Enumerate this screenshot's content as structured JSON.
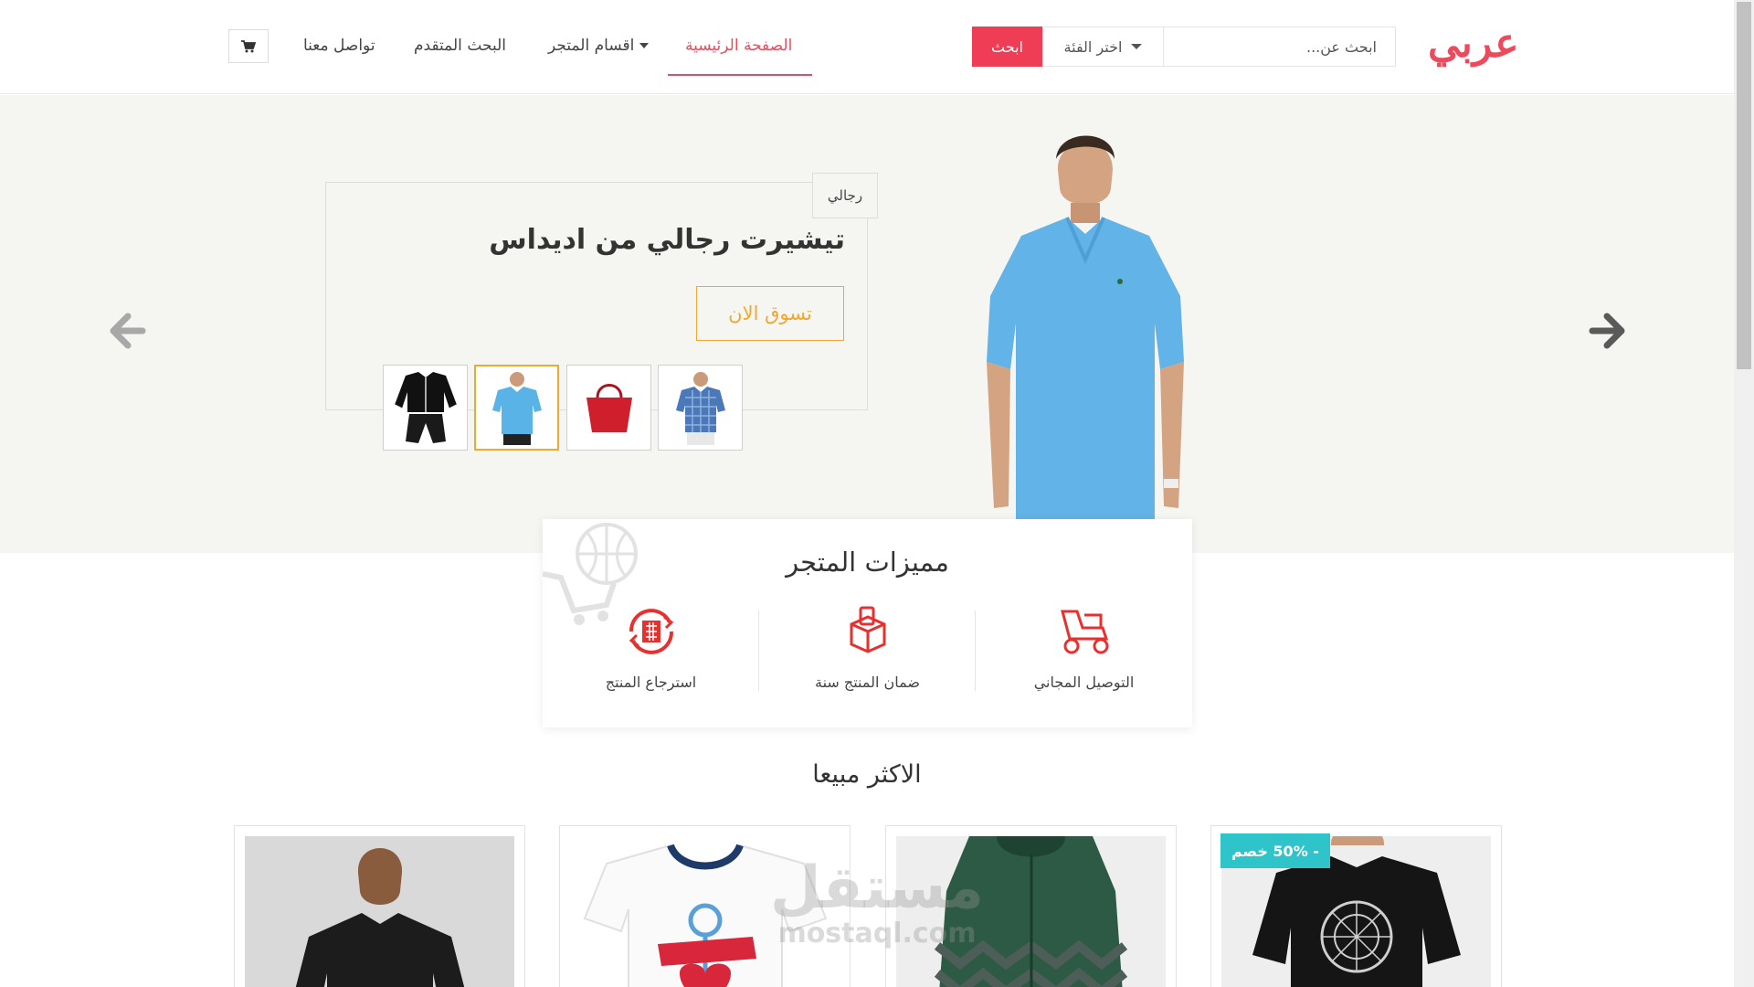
{
  "header": {
    "logo": "عربي",
    "search_placeholder": "ابحث عن...",
    "category_select": "اختر الفئة",
    "search_button": "ابحث",
    "nav": {
      "home": "الصفحة الرئيسية",
      "categories": "اقسام المتجر",
      "advanced_search": "البحث المتقدم",
      "contact": "تواصل معنا"
    },
    "cart_icon": "shopping-cart-icon"
  },
  "hero": {
    "tag": "رجالي",
    "title": "تيشيرت رجالي من اديداس",
    "cta": "تسوق الان",
    "thumbnails": [
      "tracksuit",
      "blue-polo",
      "red-handbag",
      "plaid-shirt"
    ],
    "active_thumbnail": "blue-polo",
    "prev_icon": "arrow-left-icon",
    "next_icon": "arrow-right-icon"
  },
  "features": {
    "title": "مميزات المتجر",
    "items": [
      {
        "label": "التوصيل المجاني",
        "icon": "delivery-scooter-icon"
      },
      {
        "label": "ضمان المنتج سنة",
        "icon": "guarantee-box-icon"
      },
      {
        "label": "استرجاع المنتج",
        "icon": "return-product-icon"
      }
    ]
  },
  "best_sellers": {
    "title": "الاكثر مبيعا",
    "products": [
      {
        "image": "black-print-tshirt",
        "badge": "- 50% خصم"
      },
      {
        "image": "green-puffer-jacket"
      },
      {
        "image": "kids-mummy-tshirt"
      },
      {
        "image": "black-sport-tshirt"
      }
    ]
  },
  "watermark": {
    "arabic": "مستقل",
    "latin": "mostaql.com"
  },
  "colors": {
    "brand": "#ef4a5c",
    "search_button": "#ef3d55",
    "accent_orange": "#f0a830",
    "sale_badge": "#2ec4c9",
    "hero_bg": "#f5f5f2"
  }
}
